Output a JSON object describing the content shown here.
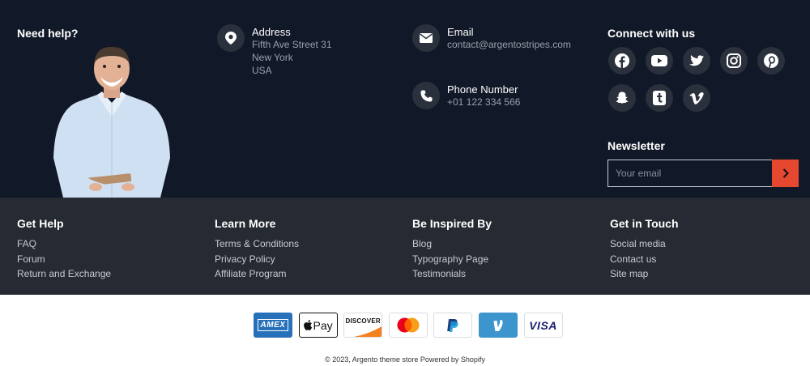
{
  "top": {
    "need_help": "Need help?",
    "address": {
      "title": "Address",
      "lines": [
        "Fifth Ave Street 31",
        "New York",
        "USA"
      ]
    },
    "email": {
      "title": "Email",
      "value": "contact@argentostripes.com"
    },
    "phone": {
      "title": "Phone Number",
      "value": "+01 122 334 566"
    },
    "connect_title": "Connect with us",
    "social_icons": [
      "facebook-icon",
      "youtube-icon",
      "twitter-icon",
      "instagram-icon",
      "pinterest-icon",
      "snapchat-icon",
      "tumblr-icon",
      "vimeo-icon"
    ],
    "newsletter_title": "Newsletter",
    "newsletter_placeholder": "Your email"
  },
  "columns": [
    {
      "title": "Get Help",
      "links": [
        "FAQ",
        "Forum",
        "Return and Exchange"
      ]
    },
    {
      "title": "Learn More",
      "links": [
        "Terms & Conditions",
        "Privacy Policy",
        "Affiliate Program"
      ]
    },
    {
      "title": "Be Inspired By",
      "links": [
        "Blog",
        "Typography Page",
        "Testimonials"
      ]
    },
    {
      "title": "Get in Touch",
      "links": [
        "Social media",
        "Contact us",
        "Site map"
      ]
    }
  ],
  "payments": {
    "amex": "AMEX",
    "applepay": "Pay",
    "discover": "DISCOVER",
    "visa": "VISA"
  },
  "copyright": "© 2023, Argento theme store Powered by Shopify",
  "colors": {
    "dark": "#111827",
    "mid": "#252a33",
    "accent": "#e5472f"
  }
}
